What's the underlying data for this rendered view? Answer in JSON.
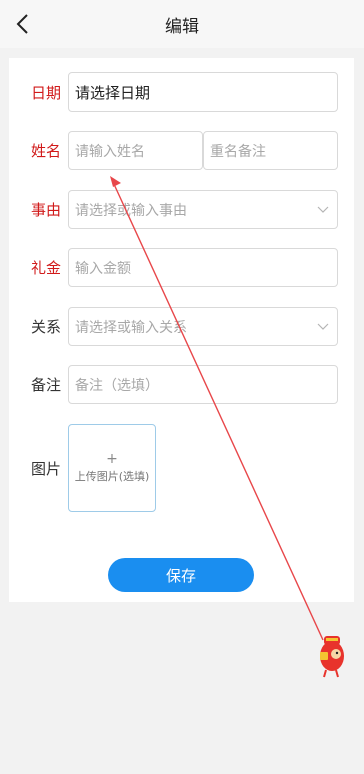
{
  "header": {
    "title": "编辑"
  },
  "form": {
    "date": {
      "label": "日期",
      "value": "请选择日期"
    },
    "name": {
      "label": "姓名",
      "placeholder": "请输入姓名",
      "remark_placeholder": "重名备注"
    },
    "event": {
      "label": "事由",
      "placeholder": "请选择或输入事由"
    },
    "gift": {
      "label": "礼金",
      "placeholder": "输入金额"
    },
    "relation": {
      "label": "关系",
      "placeholder": "请选择或输入关系"
    },
    "note": {
      "label": "备注",
      "placeholder": "备注（选填）"
    },
    "image": {
      "label": "图片",
      "plus": "+",
      "upload_text": "上传图片(选填)"
    }
  },
  "actions": {
    "save_label": "保存"
  },
  "colors": {
    "required_label": "#d11a1a",
    "primary_button": "#1a8ef0",
    "annotation_arrow": "#e8474a"
  },
  "icons": {
    "back": "chevron-left-icon",
    "dropdown": "chevron-down-icon"
  }
}
